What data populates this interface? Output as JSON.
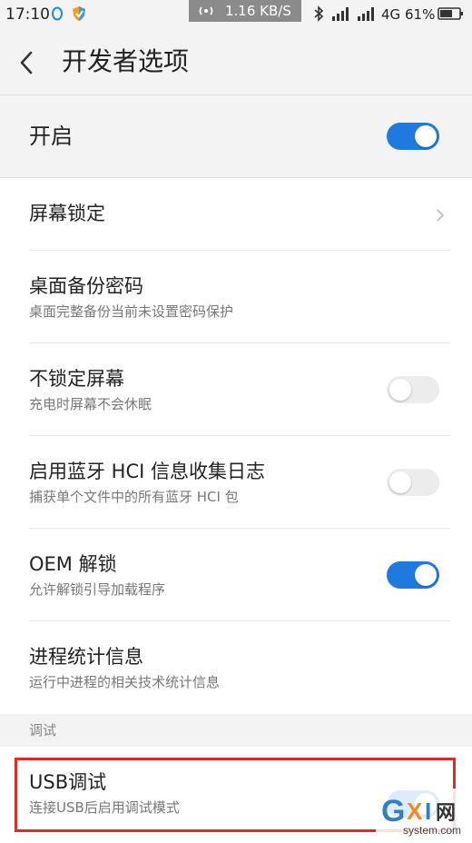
{
  "status_bar": {
    "time": "17:10",
    "speed": "1.16 KB/S",
    "network_label": "4G",
    "battery": "61%"
  },
  "header": {
    "title": "开发者选项"
  },
  "master": {
    "label": "开启",
    "enabled": true
  },
  "settings": [
    {
      "title": "屏幕锁定",
      "subtitle": ""
    },
    {
      "title": "桌面备份密码",
      "subtitle": "桌面完整备份当前未设置密码保护"
    },
    {
      "title": "不锁定屏幕",
      "subtitle": "充电时屏幕不会休眠",
      "enabled": false
    },
    {
      "title": "启用蓝牙 HCI 信息收集日志",
      "subtitle": "捕获单个文件中的所有蓝牙 HCI 包",
      "enabled": false
    },
    {
      "title": "OEM 解锁",
      "subtitle": "允许解锁引导加载程序",
      "enabled": true
    },
    {
      "title": "进程统计信息",
      "subtitle": "运行中进程的相关技术统计信息"
    }
  ],
  "section": {
    "label": "调试"
  },
  "usb": {
    "title": "USB调试",
    "subtitle": "连接USB后启用调试模式",
    "enabled": true
  },
  "watermark": {
    "brand": "GXI网",
    "site": "system.com"
  },
  "colors": {
    "accent": "#1f7ae0",
    "highlight": "#e02a2a"
  }
}
